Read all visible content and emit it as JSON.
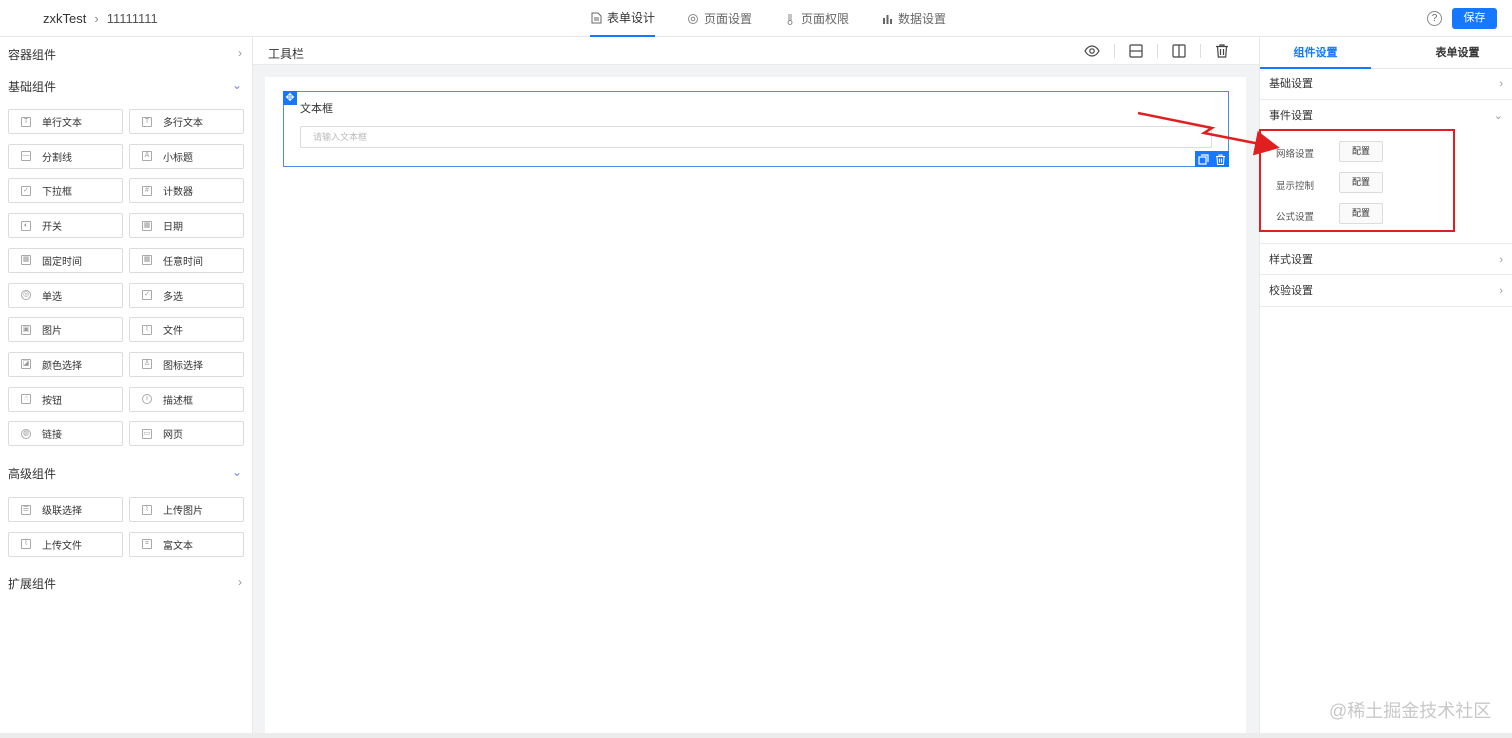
{
  "header": {
    "app": "zxkTest",
    "page": "11111111",
    "tabs": [
      {
        "label": "表单设计",
        "icon": "document-icon",
        "active": true
      },
      {
        "label": "页面设置",
        "icon": "gear-icon",
        "active": false
      },
      {
        "label": "页面权限",
        "icon": "thermometer-icon",
        "active": false
      },
      {
        "label": "数据设置",
        "icon": "bar-chart-icon",
        "active": false
      }
    ],
    "help": "?",
    "save_label": "保存",
    "accent": "#1677ff"
  },
  "left": {
    "sections": {
      "container": "容器组件",
      "basic": "基础组件",
      "advanced": "高级组件",
      "extension": "扩展组件"
    },
    "basic_items": [
      {
        "label": "单行文本",
        "icon": "text-icon"
      },
      {
        "label": "多行文本",
        "icon": "textarea-icon"
      },
      {
        "label": "分割线",
        "icon": "divider-icon"
      },
      {
        "label": "小标题",
        "icon": "subtitle-icon"
      },
      {
        "label": "下拉框",
        "icon": "select-icon"
      },
      {
        "label": "计数器",
        "icon": "counter-icon"
      },
      {
        "label": "开关",
        "icon": "switch-icon"
      },
      {
        "label": "日期",
        "icon": "calendar-icon"
      },
      {
        "label": "固定时间",
        "icon": "calendar-icon"
      },
      {
        "label": "任意时间",
        "icon": "calendar-icon"
      },
      {
        "label": "单选",
        "icon": "radio-icon"
      },
      {
        "label": "多选",
        "icon": "checkbox-icon"
      },
      {
        "label": "图片",
        "icon": "image-icon"
      },
      {
        "label": "文件",
        "icon": "paperclip-icon"
      },
      {
        "label": "颜色选择",
        "icon": "color-icon"
      },
      {
        "label": "图标选择",
        "icon": "user-icon"
      },
      {
        "label": "按钮",
        "icon": "button-icon"
      },
      {
        "label": "描述框",
        "icon": "info-icon"
      },
      {
        "label": "链接",
        "icon": "globe-icon"
      },
      {
        "label": "网页",
        "icon": "webpage-icon"
      }
    ],
    "advanced_items": [
      {
        "label": "级联选择",
        "icon": "cascade-icon"
      },
      {
        "label": "上传图片",
        "icon": "paperclip-icon"
      },
      {
        "label": "上传文件",
        "icon": "paperclip-icon"
      },
      {
        "label": "富文本",
        "icon": "richtext-icon"
      }
    ]
  },
  "center": {
    "toolbar_title": "工具栏",
    "field": {
      "label": "文本框",
      "placeholder": "请输入文本框"
    }
  },
  "right": {
    "tabs": [
      "组件设置",
      "表单设置"
    ],
    "rows": {
      "basic": "基础设置",
      "event": "事件设置",
      "style": "样式设置",
      "validate": "校验设置"
    },
    "event_items": [
      {
        "label": "网络设置",
        "button": "配置"
      },
      {
        "label": "显示控制",
        "button": "配置"
      },
      {
        "label": "公式设置",
        "button": "配置"
      }
    ],
    "highlight_color": "#e02020"
  },
  "watermark": "@稀土掘金技术社区"
}
